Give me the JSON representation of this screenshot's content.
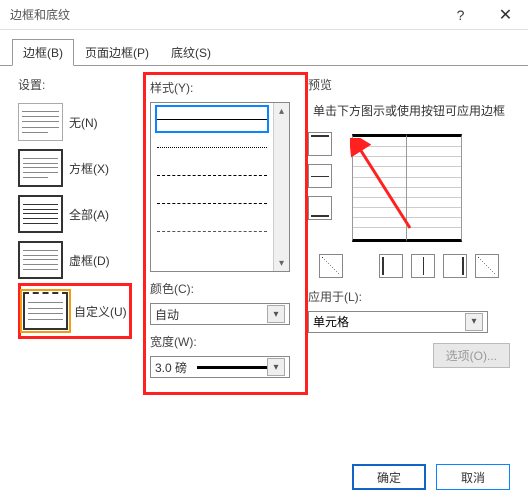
{
  "title": "边框和底纹",
  "tabs": {
    "borders": "边框(B)",
    "page_borders": "页面边框(P)",
    "shading": "底纹(S)"
  },
  "settings_label": "设置:",
  "settings": [
    {
      "label": "无(N)"
    },
    {
      "label": "方框(X)"
    },
    {
      "label": "全部(A)"
    },
    {
      "label": "虚框(D)"
    },
    {
      "label": "自定义(U)"
    }
  ],
  "style_label": "样式(Y):",
  "color_label": "颜色(C):",
  "color_value": "自动",
  "width_label": "宽度(W):",
  "width_value": "3.0 磅",
  "preview_label": "预览",
  "preview_hint": "单击下方图示或使用按钮可应用边框",
  "apply_label": "应用于(L):",
  "apply_value": "单元格",
  "options_btn": "选项(O)...",
  "ok": "确定",
  "cancel": "取消"
}
